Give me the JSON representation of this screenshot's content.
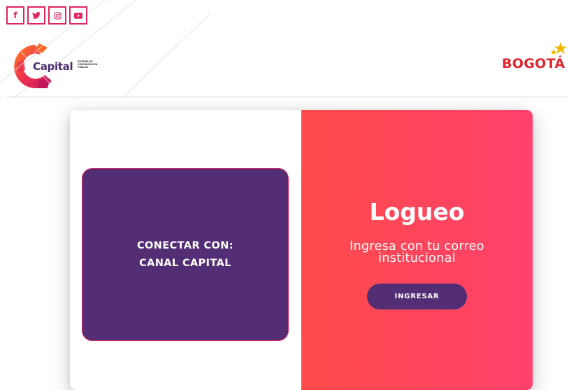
{
  "header": {
    "social": [
      {
        "icon": "facebook-icon",
        "glyph": "f"
      },
      {
        "icon": "twitter-icon"
      },
      {
        "icon": "instagram-icon"
      },
      {
        "icon": "youtube-icon"
      }
    ],
    "logo": {
      "name": "Capital",
      "tagline": "Sistema de Comunicación Pública"
    },
    "partner_logo": {
      "name": "BOGOTÁ"
    }
  },
  "login": {
    "connect_line1": "CONECTAR CON:",
    "connect_line2": "CANAL CAPITAL",
    "title": "Logueo",
    "subtitle": "Ingresa con tu correo institucional",
    "button_label": "INGRESAR"
  },
  "colors": {
    "accent_pink": "#e0245e",
    "purple": "#532e74",
    "gradient_start": "#ff4b4b",
    "gradient_end": "#ff416c",
    "bogota_red": "#e0262f"
  }
}
